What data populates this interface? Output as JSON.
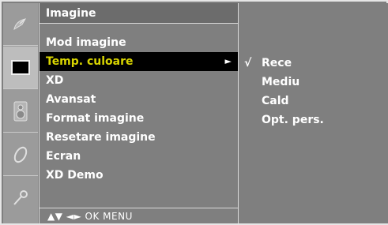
{
  "menu": {
    "title": "Imagine",
    "items": [
      {
        "label": "Mod imagine"
      },
      {
        "label": "Temp. culoare",
        "arrow": "►"
      },
      {
        "label": "XD"
      },
      {
        "label": "Avansat"
      },
      {
        "label": "Format imagine"
      },
      {
        "label": "Resetare imagine"
      },
      {
        "label": "Ecran"
      },
      {
        "label": "XD Demo"
      }
    ],
    "footer": "▲▼  ◄►  OK  MENU"
  },
  "options": {
    "check_mark": "√",
    "items": [
      {
        "label": "Rece",
        "checked": true
      },
      {
        "label": "Mediu",
        "checked": false
      },
      {
        "label": "Cald",
        "checked": false
      },
      {
        "label": "Opt. pers.",
        "checked": false
      }
    ]
  },
  "icons": [
    "satellite-dish-icon",
    "picture-icon",
    "speaker-icon",
    "clock-icon",
    "key-icon"
  ],
  "colors": {
    "background": "#7f7f7f",
    "selected_bg": "#000000",
    "selected_text": "#d9d500",
    "text": "#ffffff"
  }
}
